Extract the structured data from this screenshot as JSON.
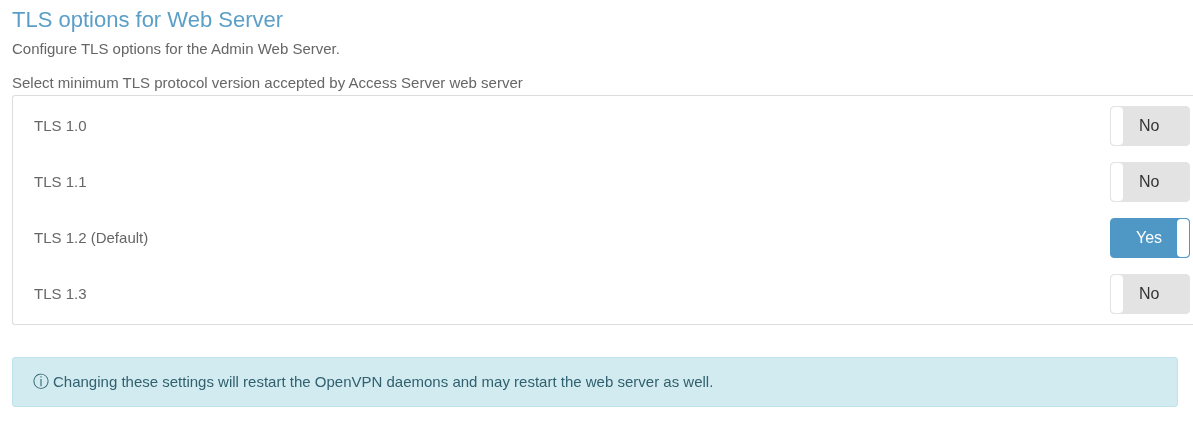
{
  "title": "TLS options for Web Server",
  "description": "Configure TLS options for the Admin Web Server.",
  "section_label": "Select minimum TLS protocol version accepted by Access Server web server",
  "options": [
    {
      "label": "TLS 1.0",
      "on": false,
      "toggle_text": "No"
    },
    {
      "label": "TLS 1.1",
      "on": false,
      "toggle_text": "No"
    },
    {
      "label": "TLS 1.2 (Default)",
      "on": true,
      "toggle_text": "Yes"
    },
    {
      "label": "TLS 1.3",
      "on": false,
      "toggle_text": "No"
    }
  ],
  "alert": {
    "icon_text": "ⓘ",
    "text": "Changing these settings will restart the OpenVPN daemons and may restart the web server as well."
  }
}
